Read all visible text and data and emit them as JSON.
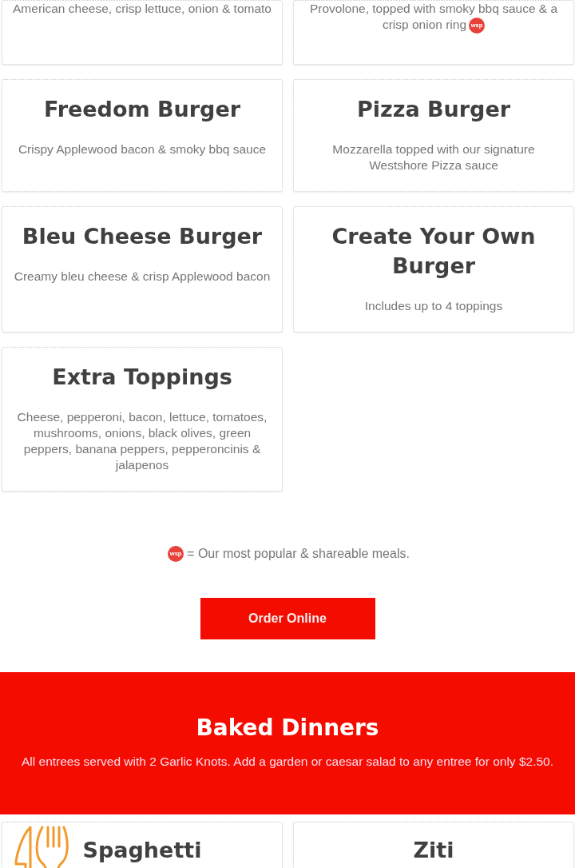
{
  "burger_items": [
    {
      "description": "American cheese, crisp lettuce, onion & tomato"
    },
    {
      "description": "Provolone, topped with smoky bbq sauce & a crisp onion ring",
      "badge": "wsp"
    },
    {
      "title": "Freedom Burger",
      "description": "Crispy Applewood bacon & smoky bbq sauce"
    },
    {
      "title": "Pizza Burger",
      "description": "Mozzarella topped with our signature Westshore Pizza sauce"
    },
    {
      "title": "Bleu Cheese Burger",
      "description": "Creamy bleu cheese & crisp Applewood bacon"
    },
    {
      "title": "Create Your Own Burger",
      "description": "Includes up to 4 toppings"
    },
    {
      "title": "Extra Toppings",
      "description": "Cheese, pepperoni, bacon, lettuce, tomatoes, mushrooms, onions, black olives, green peppers, banana peppers, pepperoncinis & jalapenos"
    }
  ],
  "legend": {
    "badge": "wsp",
    "text": "= Our most popular & shareable meals."
  },
  "order_button": {
    "label": "Order Online"
  },
  "section": {
    "title": "Baked Dinners",
    "subtitle": "All entrees served with 2 Garlic Knots. Add a garden or caesar salad to any entree for only $2.50."
  },
  "dinner_items": [
    {
      "title": "Spaghetti"
    },
    {
      "title": "Ziti"
    }
  ]
}
